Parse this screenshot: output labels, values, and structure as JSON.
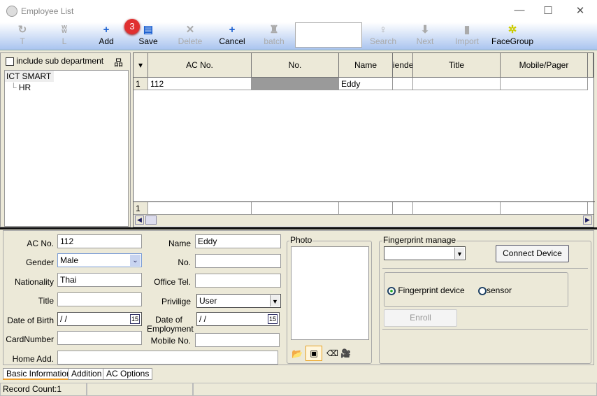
{
  "window": {
    "title": "Employee List",
    "minimize": "—",
    "maximize": "☐",
    "close": "✕"
  },
  "toolbar": {
    "badge": "3",
    "buttons": [
      {
        "label": "T",
        "icon": "↻",
        "enabled": false
      },
      {
        "label": "L",
        "icon": "ʬ",
        "enabled": false
      },
      {
        "label": "Add",
        "icon": "+",
        "enabled": true
      },
      {
        "label": "Save",
        "icon": "▤",
        "enabled": true
      },
      {
        "label": "Delete",
        "icon": "✕",
        "enabled": false
      },
      {
        "label": "Cancel",
        "icon": "+",
        "enabled": true
      },
      {
        "label": "batch",
        "icon": "♜",
        "enabled": false
      }
    ],
    "buttons2": [
      {
        "label": "Search",
        "icon": "♀",
        "enabled": false
      },
      {
        "label": "Next",
        "icon": "⬇",
        "enabled": false
      },
      {
        "label": "Import",
        "icon": "▮",
        "enabled": false
      },
      {
        "label": "FaceGroup",
        "icon": "✲",
        "enabled": true
      }
    ]
  },
  "left": {
    "include_sub": "include sub department",
    "tree": [
      {
        "label": "ICT SMART"
      },
      {
        "label": "HR"
      }
    ]
  },
  "grid": {
    "columns": [
      "AC No.",
      "No.",
      "Name",
      "iende",
      "Title",
      "Mobile/Pager"
    ],
    "rows": [
      {
        "index": "1",
        "ac_no": "112",
        "no": "",
        "name": "Eddy",
        "gender": "",
        "title": "",
        "mobile": ""
      }
    ],
    "footer_index": "1"
  },
  "form": {
    "ac_no_label": "AC No.",
    "ac_no": "112",
    "gender_label": "Gender",
    "gender": "Male",
    "nationality_label": "Nationality",
    "nationality": "Thai",
    "title_label": "Title",
    "title": "",
    "dob_label": "Date of Birth",
    "dob": " /  /",
    "card_label": "CardNumber",
    "card": "",
    "home_label": "Home Add.",
    "home": "",
    "name_label": "Name",
    "name": "Eddy",
    "no_label": "No.",
    "no": "",
    "office_label": "Office Tel.",
    "office": "",
    "priv_label": "Privilige",
    "priv": "User",
    "doe_label": "Date of Employment",
    "doe": " /  /",
    "mobile_label": "Mobile No.",
    "mobile": "",
    "cal": "15"
  },
  "photo": {
    "label": "Photo"
  },
  "fingerprint": {
    "label": "Fingerprint manage",
    "select": "",
    "connect": "Connect Device",
    "opt1": "Fingerprint device",
    "opt2": "sensor",
    "selected": "Fingerprint device",
    "enroll": "Enroll"
  },
  "tabs": [
    "Basic Information",
    "Addition",
    "AC Options"
  ],
  "active_tab": "Basic Information",
  "status": {
    "record_count": "Record Count:1"
  }
}
